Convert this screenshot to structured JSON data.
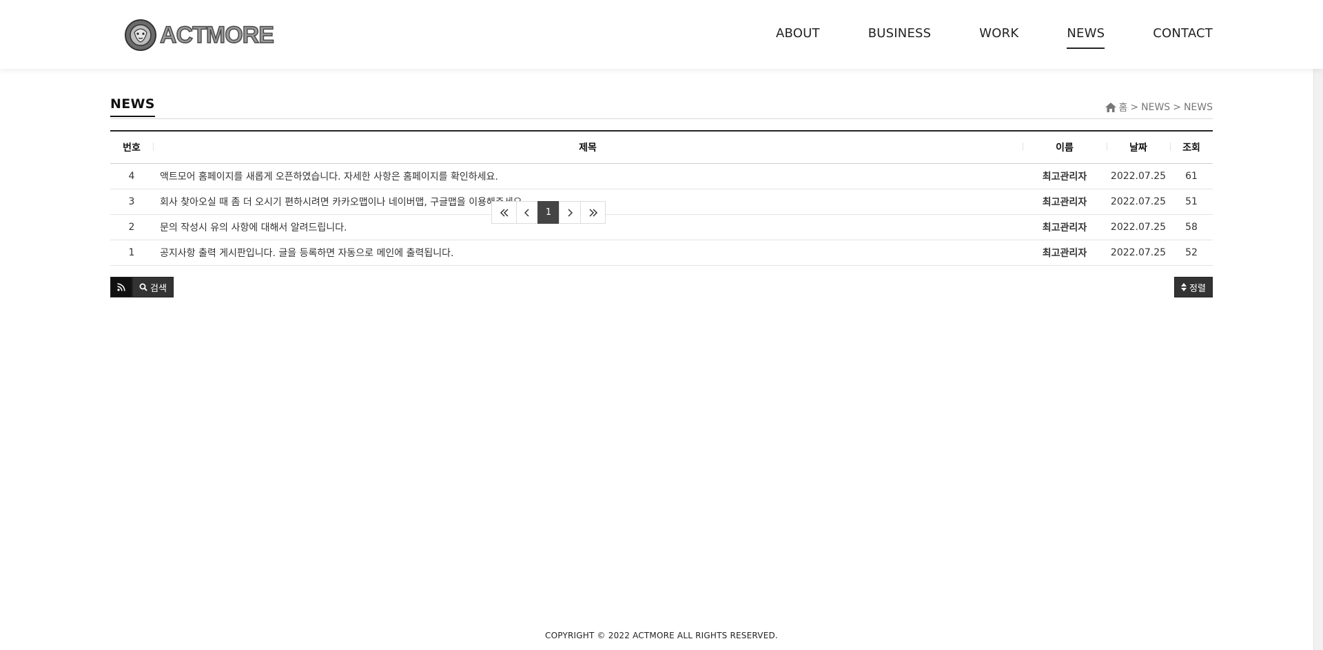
{
  "logo": {
    "text": "ACTMORE"
  },
  "nav": {
    "items": [
      {
        "label": "ABOUT"
      },
      {
        "label": "BUSINESS"
      },
      {
        "label": "WORK"
      },
      {
        "label": "NEWS"
      },
      {
        "label": "CONTACT"
      }
    ]
  },
  "page": {
    "title": "NEWS"
  },
  "breadcrumb": {
    "home": "홈",
    "sep": ">",
    "level1": "NEWS",
    "level2": "NEWS"
  },
  "table": {
    "headers": {
      "num": "번호",
      "subject": "제목",
      "name": "이름",
      "date": "날짜",
      "hits": "조회"
    },
    "rows": [
      {
        "num": "4",
        "subject": "액트모어 홈페이지를 새롭게 오픈하였습니다. 자세한 사항은 홈페이지를 확인하세요.",
        "name": "최고관리자",
        "date": "2022.07.25",
        "hits": "61"
      },
      {
        "num": "3",
        "subject": "회사 찾아오실 때 좀 더 오시기 편하시려면 카카오맵이나 네이버맵, 구글맵을 이용해주세요.",
        "name": "최고관리자",
        "date": "2022.07.25",
        "hits": "51"
      },
      {
        "num": "2",
        "subject": "문의 작성시 유의 사항에 대해서 알려드립니다.",
        "name": "최고관리자",
        "date": "2022.07.25",
        "hits": "58"
      },
      {
        "num": "1",
        "subject": "공지사항 출력 게시판입니다. 글을 등록하면 자동으로 메인에 출력됩니다.",
        "name": "최고관리자",
        "date": "2022.07.25",
        "hits": "52"
      }
    ]
  },
  "buttons": {
    "search": "검색",
    "sort": "정렬"
  },
  "pagination": {
    "current": "1"
  },
  "footer": {
    "copyright": "COPYRIGHT © 2022 ACTMORE ALL RIGHTS RESERVED."
  },
  "colors": {
    "accent": "#333333",
    "text": "#222222",
    "muted": "#777777",
    "line": "#e3e3e3"
  }
}
